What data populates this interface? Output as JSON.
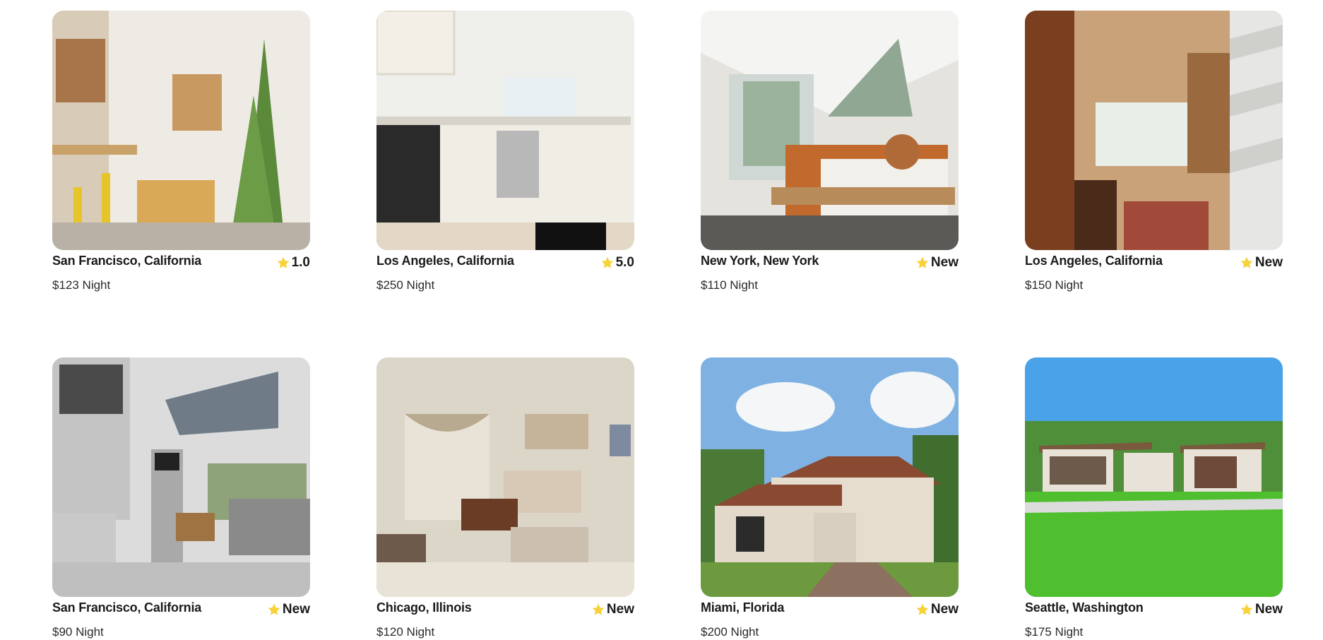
{
  "colors": {
    "star": "#f7d23a",
    "text": "#1b1b1b",
    "background": "#ffffff"
  },
  "listings": [
    {
      "location": "San Francisco, California",
      "rating": "1.0",
      "price": "$123 Night",
      "scene": "sunny-kitchen-bar"
    },
    {
      "location": "Los Angeles, California",
      "rating": "5.0",
      "price": "$250 Night",
      "scene": "white-kitchen"
    },
    {
      "location": "New York, New York",
      "rating": "New",
      "price": "$110 Night",
      "scene": "log-bed-bedroom"
    },
    {
      "location": "Los Angeles, California",
      "rating": "New",
      "price": "$150 Night",
      "scene": "spiral-stair-loft"
    },
    {
      "location": "San Francisco, California",
      "rating": "New",
      "price": "$90 Night",
      "scene": "modern-gray-living-room"
    },
    {
      "location": "Chicago, Illinois",
      "rating": "New",
      "price": "$120 Night",
      "scene": "beige-living-room"
    },
    {
      "location": "Miami, Florida",
      "rating": "New",
      "price": "$200 Night",
      "scene": "two-story-house"
    },
    {
      "location": "Seattle, Washington",
      "rating": "New",
      "price": "$175 Night",
      "scene": "single-story-house-lawn"
    }
  ]
}
